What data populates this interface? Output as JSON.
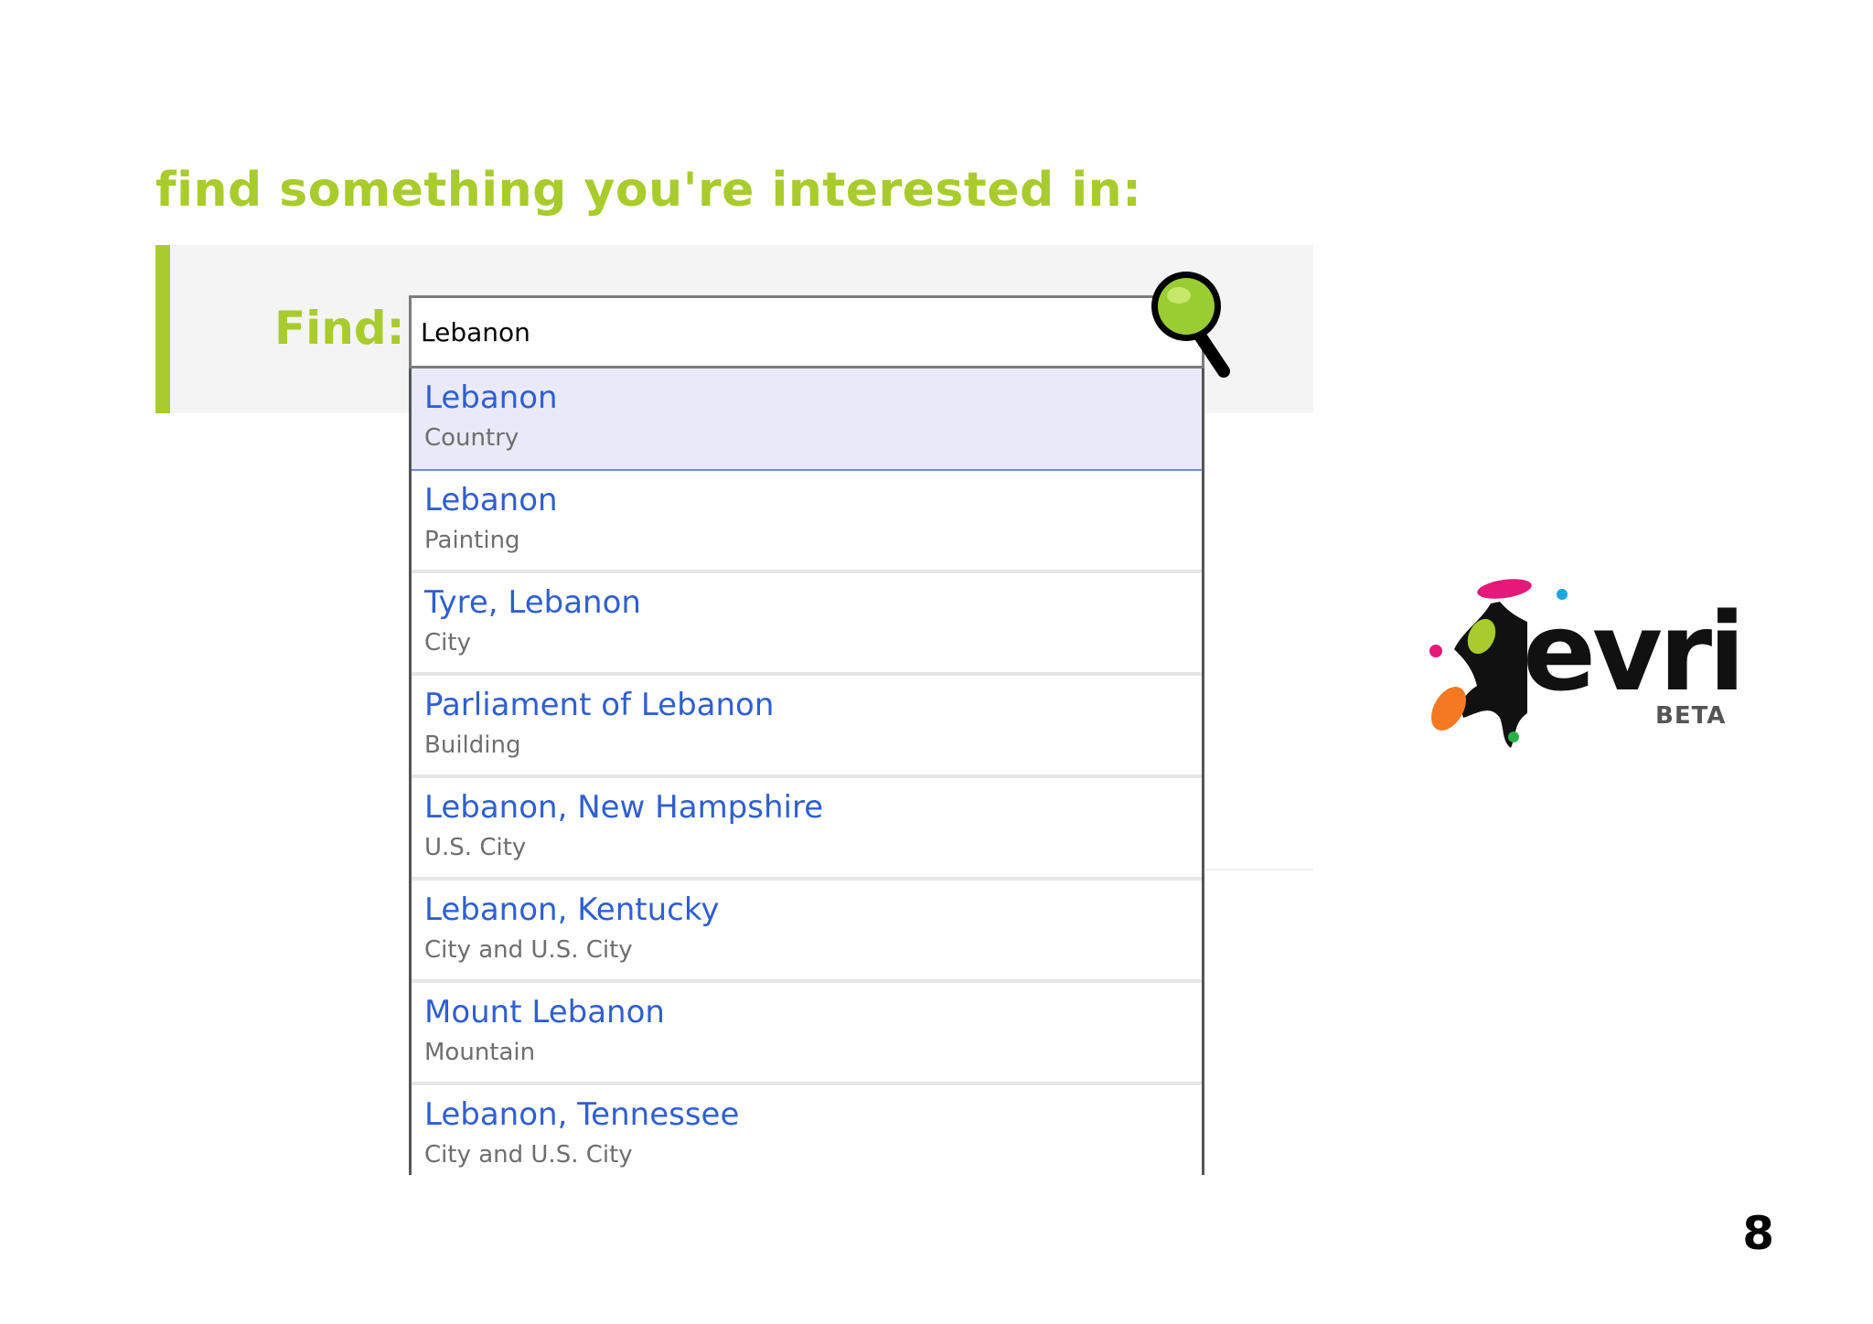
{
  "heading": "find something you're interested in:",
  "find": {
    "label": "Find:",
    "query": "Lebanon",
    "search_icon": "magnifier-icon",
    "accent_color": "#a8cc2c"
  },
  "suggestions": [
    {
      "name": "Lebanon",
      "type": "Country",
      "selected": true
    },
    {
      "name": "Lebanon",
      "type": "Painting"
    },
    {
      "name": "Tyre, Lebanon",
      "type": "City"
    },
    {
      "name": "Parliament of Lebanon",
      "type": "Building"
    },
    {
      "name": "Lebanon, New Hampshire",
      "type": "U.S. City"
    },
    {
      "name": "Lebanon, Kentucky",
      "type": "City and U.S. City"
    },
    {
      "name": "Mount Lebanon",
      "type": "Mountain"
    },
    {
      "name": "Lebanon, Tennessee",
      "type": "City and U.S. City"
    }
  ],
  "logo": {
    "text": "evri",
    "badge": "BETA"
  },
  "page_number": "8"
}
